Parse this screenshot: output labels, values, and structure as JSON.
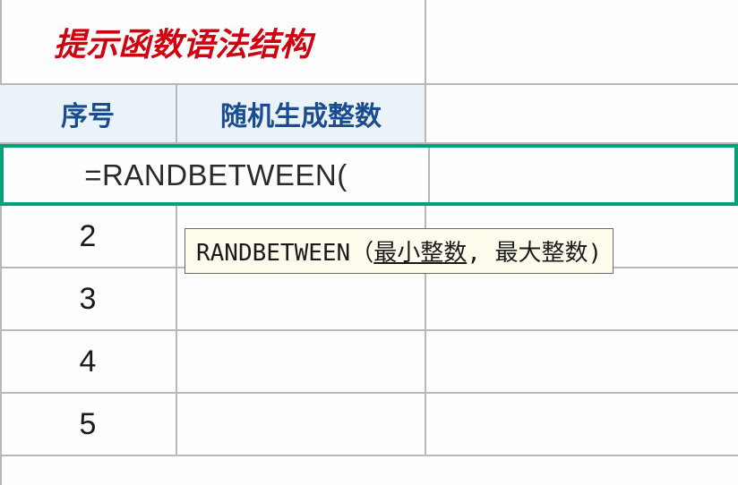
{
  "title": "提示函数语法结构",
  "headers": {
    "col_a": "序号",
    "col_b": "随机生成整数"
  },
  "formula": "=RANDBETWEEN(",
  "tooltip": {
    "func_name": "RANDBETWEEN",
    "open_paren": "（",
    "arg1": "最小整数",
    "separator": ", ",
    "arg2": "最大整数",
    "close_paren": ")"
  },
  "rows": [
    {
      "seq": "2"
    },
    {
      "seq": "3"
    },
    {
      "seq": "4"
    },
    {
      "seq": "5"
    }
  ]
}
